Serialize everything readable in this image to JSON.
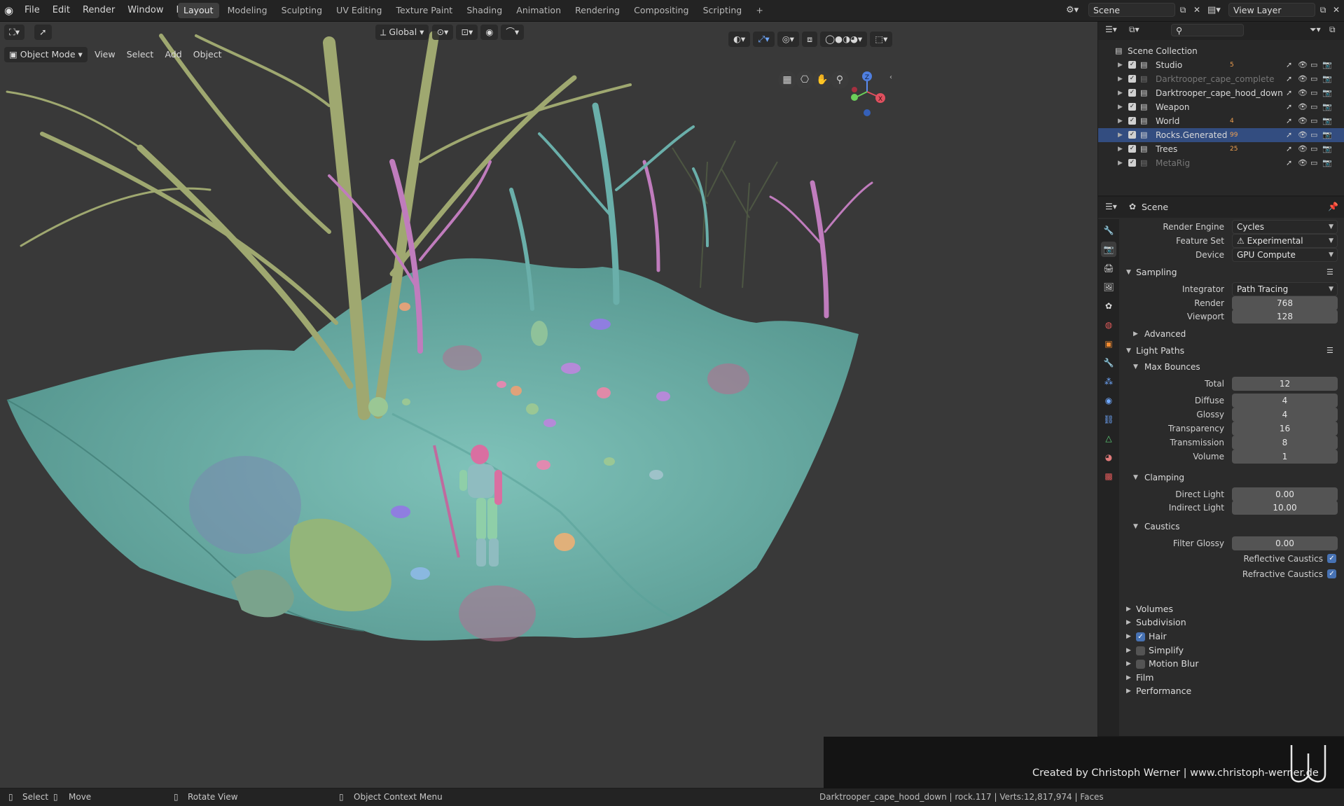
{
  "topbar": {
    "menus": [
      "File",
      "Edit",
      "Render",
      "Window",
      "Help"
    ],
    "workspaces": [
      "Layout",
      "Modeling",
      "Sculpting",
      "UV Editing",
      "Texture Paint",
      "Shading",
      "Animation",
      "Rendering",
      "Compositing",
      "Scripting"
    ],
    "active_workspace": "Layout",
    "add_tab": "+",
    "scene_name": "Scene",
    "view_layer": "View Layer"
  },
  "viewport": {
    "mode": "Object Mode",
    "menus": [
      "View",
      "Select",
      "Add",
      "Object"
    ],
    "transform_orientation": "Global",
    "gizmo_axes": {
      "x": "X",
      "y": "Y",
      "z": "Z"
    }
  },
  "outliner": {
    "root": "Scene Collection",
    "rows": [
      {
        "name": "Studio",
        "badge": "5",
        "selected": false,
        "dim": false
      },
      {
        "name": "Darktrooper_cape_complete",
        "badge": "",
        "selected": false,
        "dim": true
      },
      {
        "name": "Darktrooper_cape_hood_down",
        "badge": "",
        "selected": false,
        "dim": false
      },
      {
        "name": "Weapon",
        "badge": "",
        "selected": false,
        "dim": false
      },
      {
        "name": "World",
        "badge": "4",
        "selected": false,
        "dim": false
      },
      {
        "name": "Rocks.Generated",
        "badge": "99",
        "selected": true,
        "dim": false
      },
      {
        "name": "Trees",
        "badge": "25",
        "selected": false,
        "dim": false
      },
      {
        "name": "MetaRig",
        "badge": "",
        "selected": false,
        "dim": true
      }
    ]
  },
  "properties": {
    "context": "Scene",
    "render_engine": {
      "label": "Render Engine",
      "value": "Cycles"
    },
    "feature_set": {
      "label": "Feature Set",
      "value": "Experimental"
    },
    "device": {
      "label": "Device",
      "value": "GPU Compute"
    },
    "sampling": {
      "title": "Sampling",
      "integrator": {
        "label": "Integrator",
        "value": "Path Tracing"
      },
      "render": {
        "label": "Render",
        "value": "768"
      },
      "viewport": {
        "label": "Viewport",
        "value": "128"
      },
      "advanced": "Advanced"
    },
    "light_paths": {
      "title": "Light Paths",
      "max_bounces": "Max Bounces",
      "total": {
        "label": "Total",
        "value": "12"
      },
      "diffuse": {
        "label": "Diffuse",
        "value": "4"
      },
      "glossy": {
        "label": "Glossy",
        "value": "4"
      },
      "transparency": {
        "label": "Transparency",
        "value": "16"
      },
      "transmission": {
        "label": "Transmission",
        "value": "8"
      },
      "volume": {
        "label": "Volume",
        "value": "1"
      },
      "clamping": "Clamping",
      "direct_light": {
        "label": "Direct Light",
        "value": "0.00"
      },
      "indirect_light": {
        "label": "Indirect Light",
        "value": "10.00"
      },
      "caustics": "Caustics",
      "filter_glossy": {
        "label": "Filter Glossy",
        "value": "0.00"
      },
      "reflective_caustics": {
        "label": "Reflective Caustics",
        "checked": true
      },
      "refractive_caustics": {
        "label": "Refractive Caustics",
        "checked": true
      }
    },
    "panels": [
      {
        "name": "Volumes",
        "checkbox": null
      },
      {
        "name": "Subdivision",
        "checkbox": null
      },
      {
        "name": "Hair",
        "checkbox": true
      },
      {
        "name": "Simplify",
        "checkbox": false
      },
      {
        "name": "Motion Blur",
        "checkbox": false
      },
      {
        "name": "Film",
        "checkbox": null
      },
      {
        "name": "Performance",
        "checkbox": null
      }
    ]
  },
  "statusbar": {
    "select": "Select",
    "move": "Move",
    "rotate_view": "Rotate View",
    "context_menu": "Object Context Menu",
    "stats": "Darktrooper_cape_hood_down | rock.117 | Verts:12,817,974 | Faces"
  },
  "credit": "Created by Christoph Werner | www.christoph-werner.de",
  "colors": {
    "selection": "#334d80",
    "accent": "#4772b3",
    "ground": "#6fb0a8",
    "tree_olive": "#a8b27a",
    "tree_pink": "#c77fc0",
    "tree_teal": "#6fb5b0"
  }
}
